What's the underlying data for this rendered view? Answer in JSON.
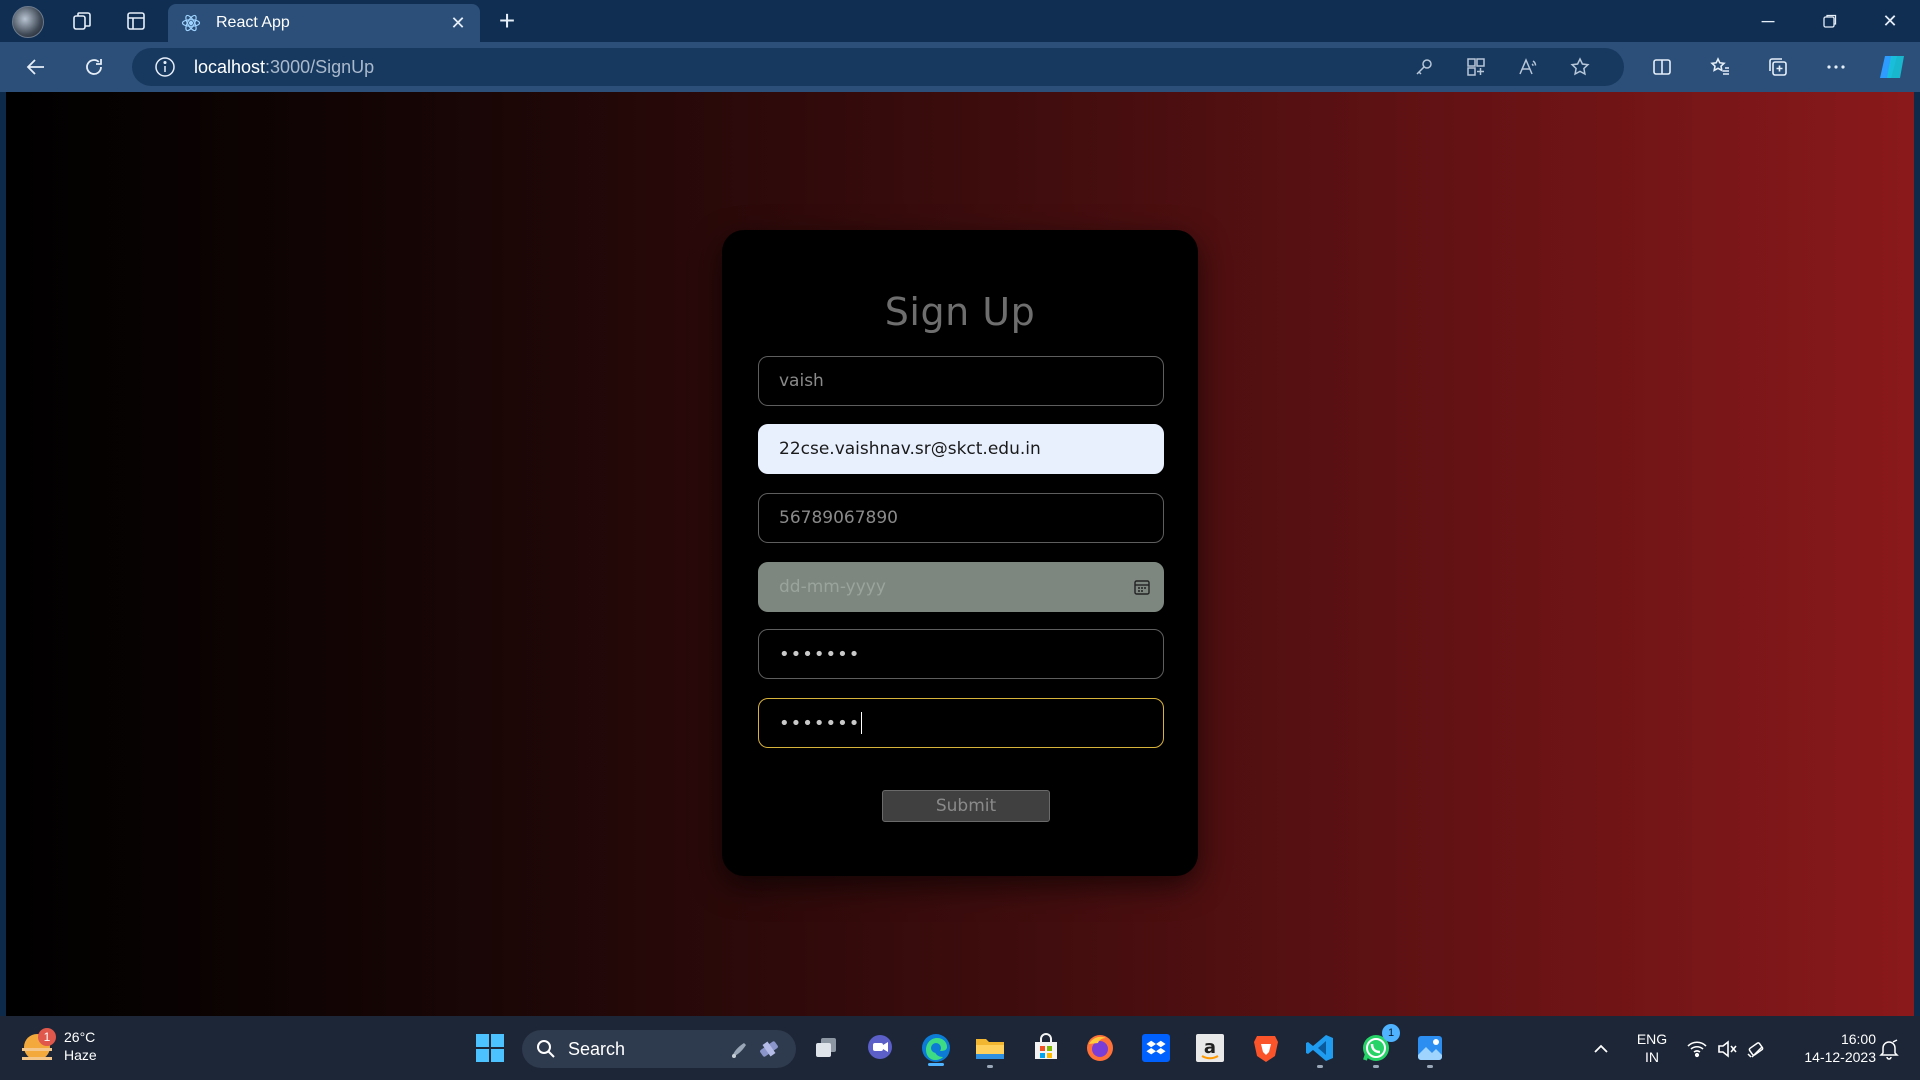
{
  "browser": {
    "tab_title": "React App",
    "url_host": "localhost",
    "url_path": ":3000/SignUp"
  },
  "form": {
    "title": "Sign Up",
    "username_value": "vaish",
    "email_value": "22cse.vaishnav.sr@skct.edu.in",
    "phone_value": "56789067890",
    "dob_placeholder": "dd-mm-yyyy",
    "password_value": "•••••••",
    "confirm_password_value": "•••••••",
    "submit_label": "Submit"
  },
  "taskbar": {
    "weather_temp": "26°C",
    "weather_desc": "Haze",
    "weather_badge": "1",
    "search_label": "Search",
    "whatsapp_badge": "1",
    "lang_line1": "ENG",
    "lang_line2": "IN",
    "time": "16:00",
    "date": "14-12-2023"
  },
  "colors": {
    "page_gradient_start": "#000000",
    "page_gradient_end": "#8a191b",
    "card_bg": "#000000",
    "focus_border": "#d8b33b",
    "autofill_bg": "#e8f0fe"
  }
}
